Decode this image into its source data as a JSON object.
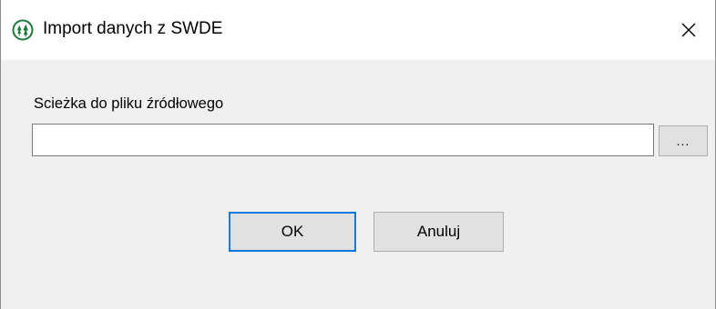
{
  "window": {
    "title": "Import danych z SWDE",
    "icon": "green-tree-logo-icon",
    "close_icon": "close-icon"
  },
  "form": {
    "path_label": "Scieżka do pliku źródłowego",
    "path_value": "",
    "browse_label": "..."
  },
  "buttons": {
    "ok_label": "OK",
    "cancel_label": "Anuluj"
  },
  "colors": {
    "accent": "#0078d7",
    "logo_green": "#1e7a3c",
    "dialog_background": "#f0f0f0",
    "button_face": "#e1e1e1"
  }
}
